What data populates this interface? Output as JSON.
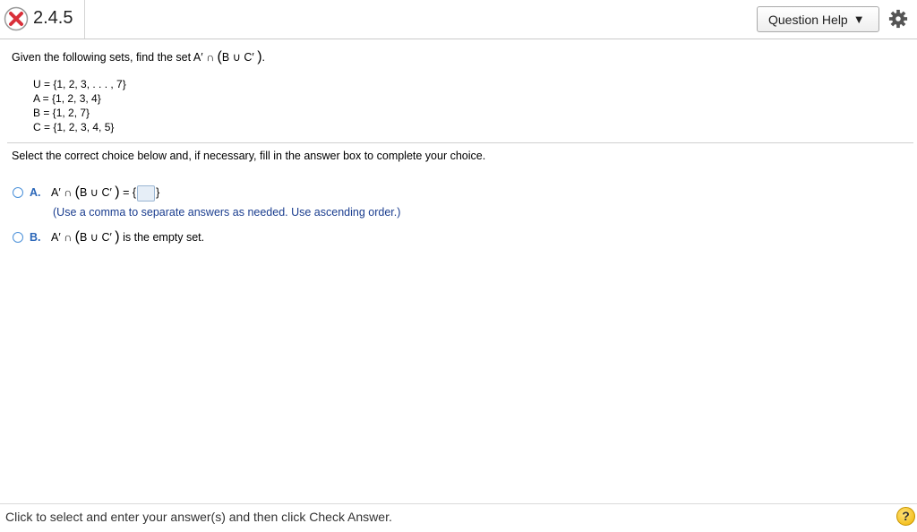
{
  "header": {
    "question_number": "2.4.5",
    "help_button_label": "Question Help",
    "help_caret": "▼",
    "status_icon": "incorrect-x-icon",
    "settings_icon": "gear-icon"
  },
  "question": {
    "prompt_prefix": "Given the following sets, find the set A",
    "prime": "′",
    "intersect": "∩",
    "open_paren": "(",
    "b": "B",
    "union": "∪",
    "c": "C",
    "close_paren": ")",
    "period": ".",
    "sets": [
      "U = {1, 2, 3, . . . , 7}",
      "A = {1, 2, 3, 4}",
      "B = {1, 2, 7}",
      "C = {1, 2, 3, 4, 5}"
    ]
  },
  "instruction": "Select the correct choice below and, if necessary, fill in the answer box to complete your choice.",
  "choices": {
    "a": {
      "letter": "A.",
      "equals_open": "= {",
      "close": "}",
      "hint": "(Use a comma to separate answers as needed. Use ascending order.)"
    },
    "b": {
      "letter": "B.",
      "suffix": "is the empty set."
    }
  },
  "footer": {
    "text": "Click to select and enter your answer(s) and then click Check Answer.",
    "help_symbol": "?"
  },
  "colors": {
    "accent": "#2a66b8",
    "hint_text": "#1a3d8f",
    "incorrect": "#d9303a",
    "help_yellow": "#f0b400"
  }
}
